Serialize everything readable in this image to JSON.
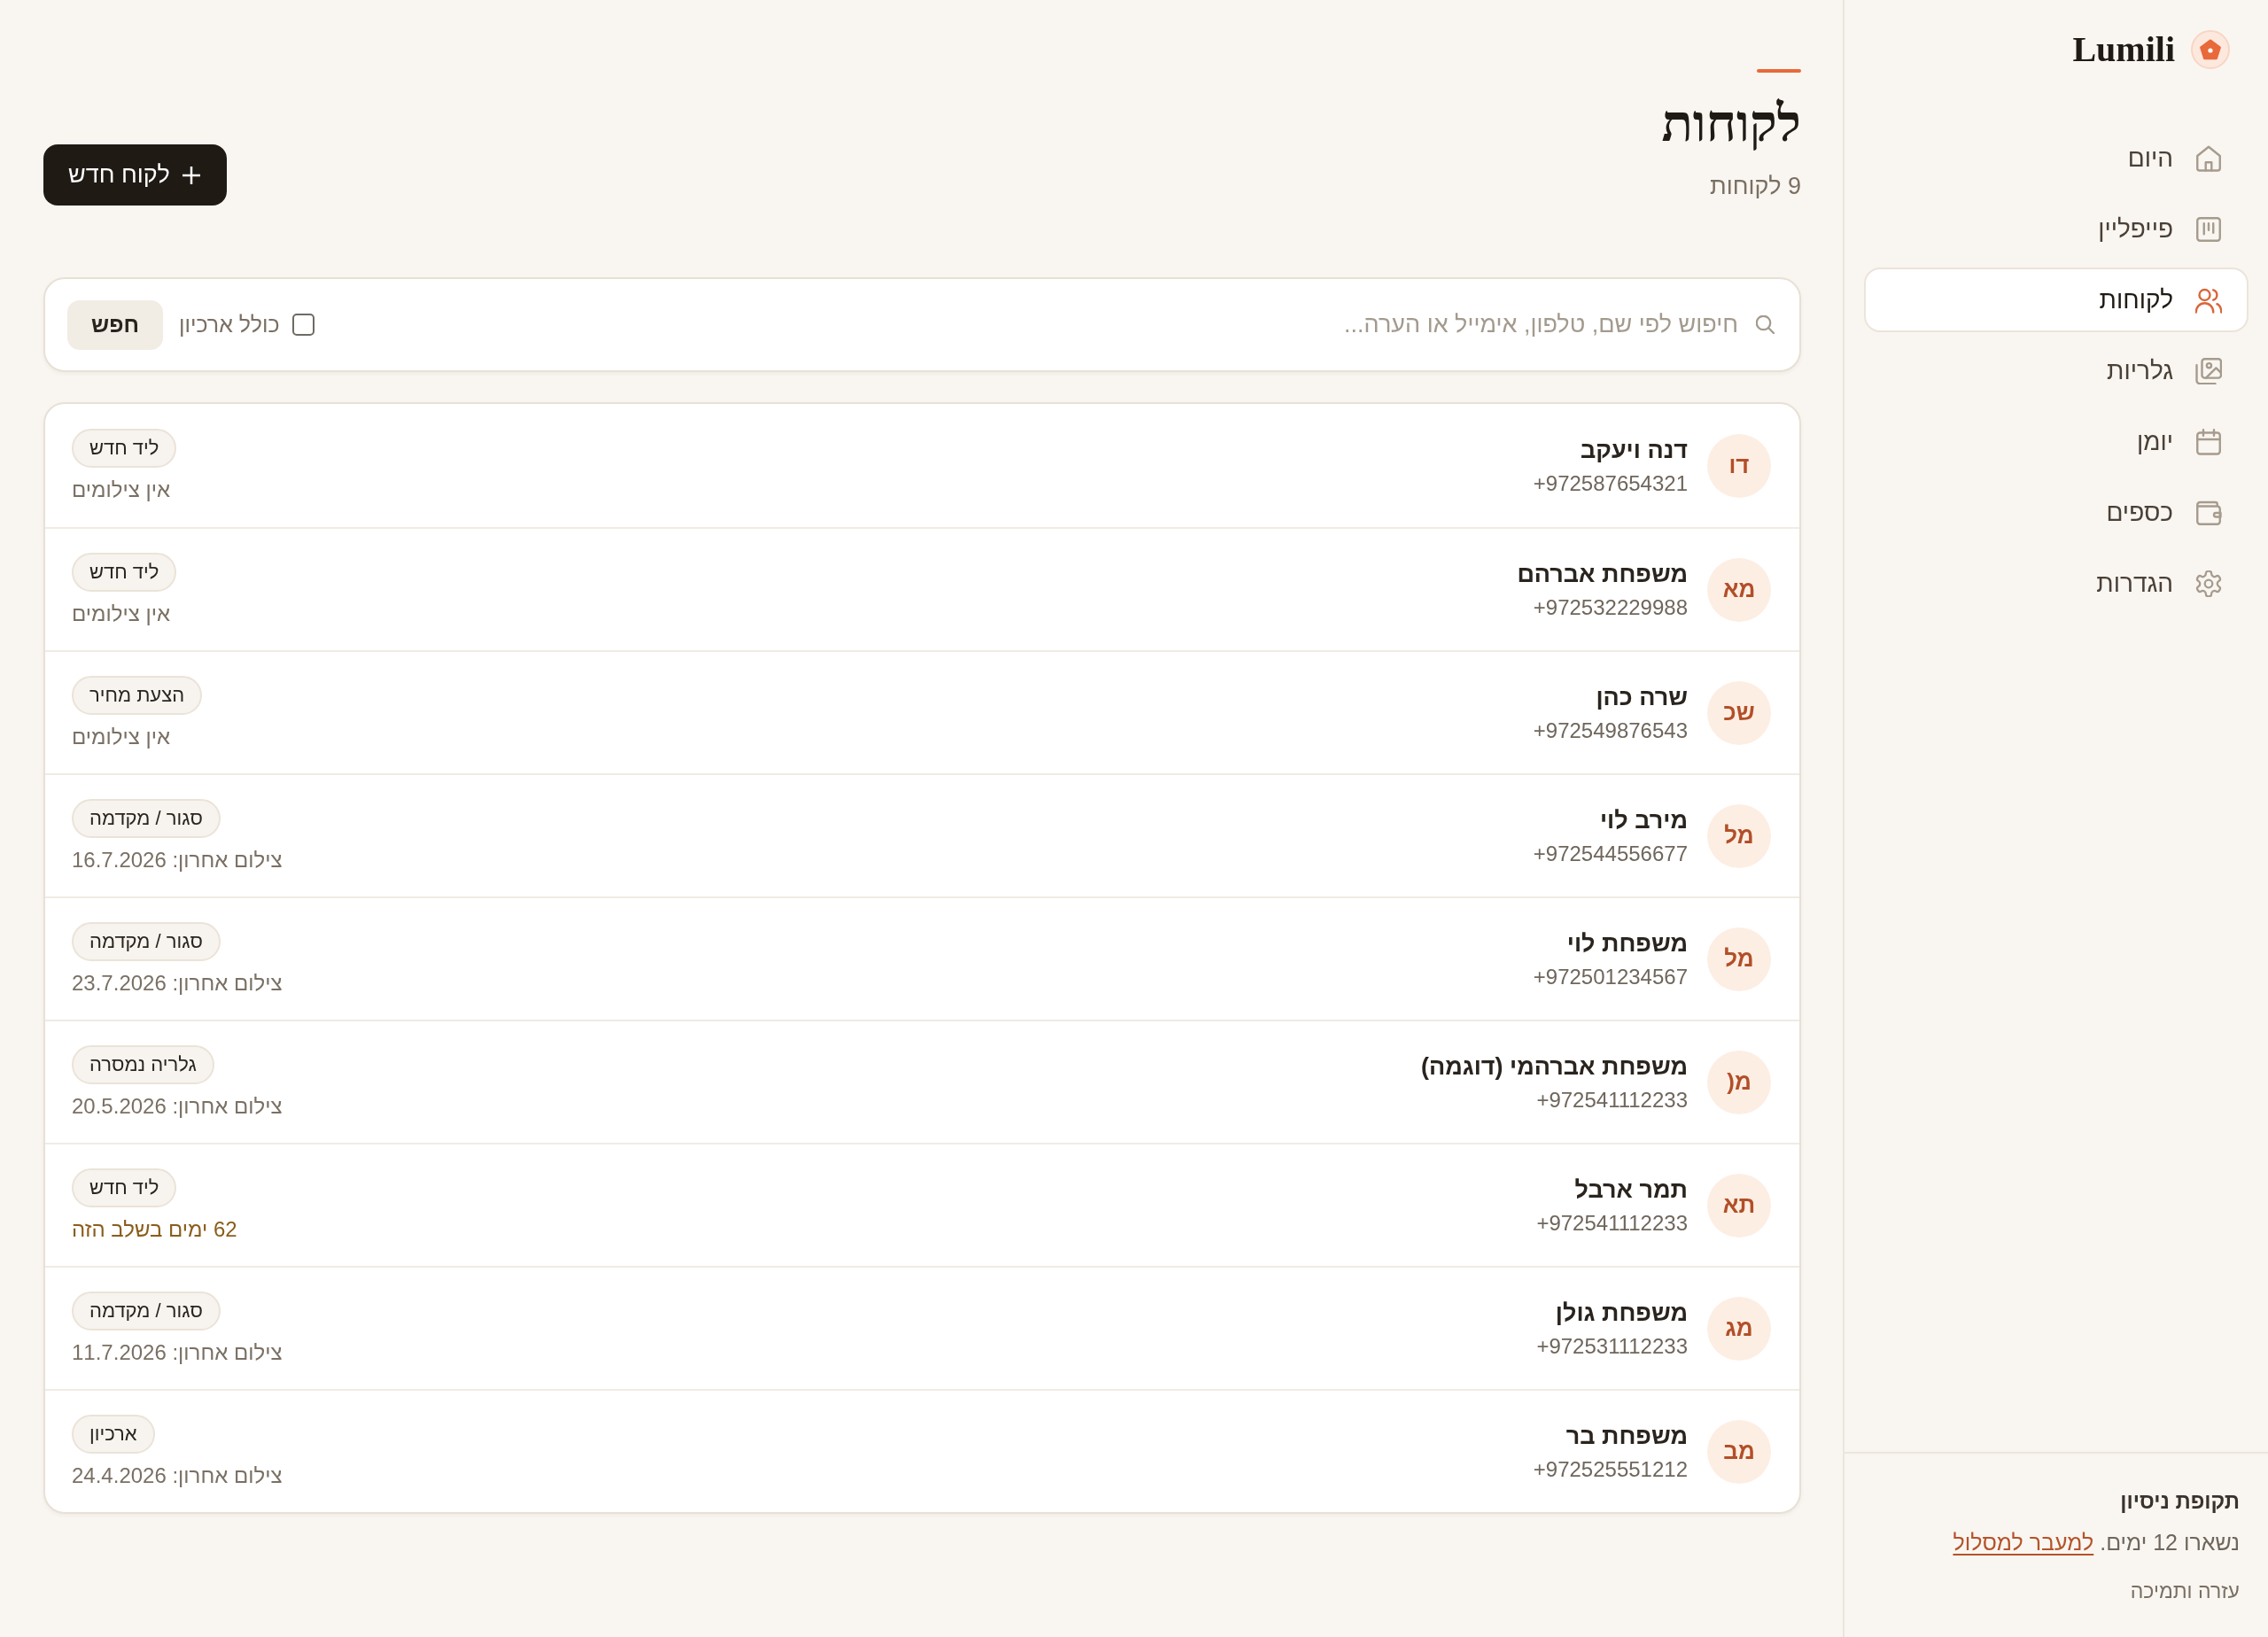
{
  "sidebar": {
    "brand": "Lumili",
    "items": [
      {
        "label": "היום",
        "selected": false
      },
      {
        "label": "פייפליין",
        "selected": false
      },
      {
        "label": "לקוחות",
        "selected": true
      },
      {
        "label": "גלריות",
        "selected": false
      },
      {
        "label": "יומן",
        "selected": false
      },
      {
        "label": "כספים",
        "selected": false
      },
      {
        "label": "הגדרות",
        "selected": false
      }
    ],
    "trial": {
      "title": "תקופת ניסיון",
      "text": "נשארו 12 ימים.",
      "link": "למעבר למסלול"
    },
    "help": "עזרה ותמיכה"
  },
  "header": {
    "title": "לקוחות",
    "count": "9 לקוחות",
    "new_button": "לקוח חדש"
  },
  "search": {
    "placeholder": "חיפוש לפי שם, טלפון, אימייל או הערה...",
    "include_archive": {
      "label": "כולל ארכיון",
      "checked": false
    },
    "button": "חפש"
  },
  "clients": [
    {
      "initials": "דו",
      "name": "דנה ויעקב",
      "phone": "+972587654321",
      "stage": "ליד חדש",
      "note": {
        "text": "אין צילומים",
        "kind": "muted"
      }
    },
    {
      "initials": "מא",
      "name": "משפחת אברהם",
      "phone": "+972532229988",
      "stage": "ליד חדש",
      "note": {
        "text": "אין צילומים",
        "kind": "muted"
      }
    },
    {
      "initials": "שכ",
      "name": "שרה כהן",
      "phone": "+972549876543",
      "stage": "הצעת מחיר",
      "note": {
        "text": "אין צילומים",
        "kind": "muted"
      }
    },
    {
      "initials": "מל",
      "name": "מירב לוי",
      "phone": "+972544556677",
      "stage": "סגור / מקדמה",
      "note": {
        "text": "צילום אחרון: 16.7.2026",
        "kind": "muted"
      }
    },
    {
      "initials": "מל",
      "name": "משפחת לוי",
      "phone": "+972501234567",
      "stage": "סגור / מקדמה",
      "note": {
        "text": "צילום אחרון: 23.7.2026",
        "kind": "muted"
      }
    },
    {
      "initials": "מ(",
      "name": "משפחת אברהמי (דוגמה)",
      "phone": "+972541112233",
      "stage": "גלריה נמסרה",
      "note": {
        "text": "צילום אחרון: 20.5.2026",
        "kind": "muted"
      }
    },
    {
      "initials": "תא",
      "name": "תמר ארבל",
      "phone": "+972541112233",
      "stage": "ליד חדש",
      "note": {
        "text": "62 ימים בשלב הזה",
        "kind": "warning"
      }
    },
    {
      "initials": "מג",
      "name": "משפחת גולן",
      "phone": "+972531112233",
      "stage": "סגור / מקדמה",
      "note": {
        "text": "צילום אחרון: 11.7.2026",
        "kind": "muted"
      }
    },
    {
      "initials": "מב",
      "name": "משפחת בר",
      "phone": "+972525551212",
      "stage": "ארכיון",
      "note": {
        "text": "צילום אחרון: 24.4.2026",
        "kind": "muted"
      }
    }
  ]
}
